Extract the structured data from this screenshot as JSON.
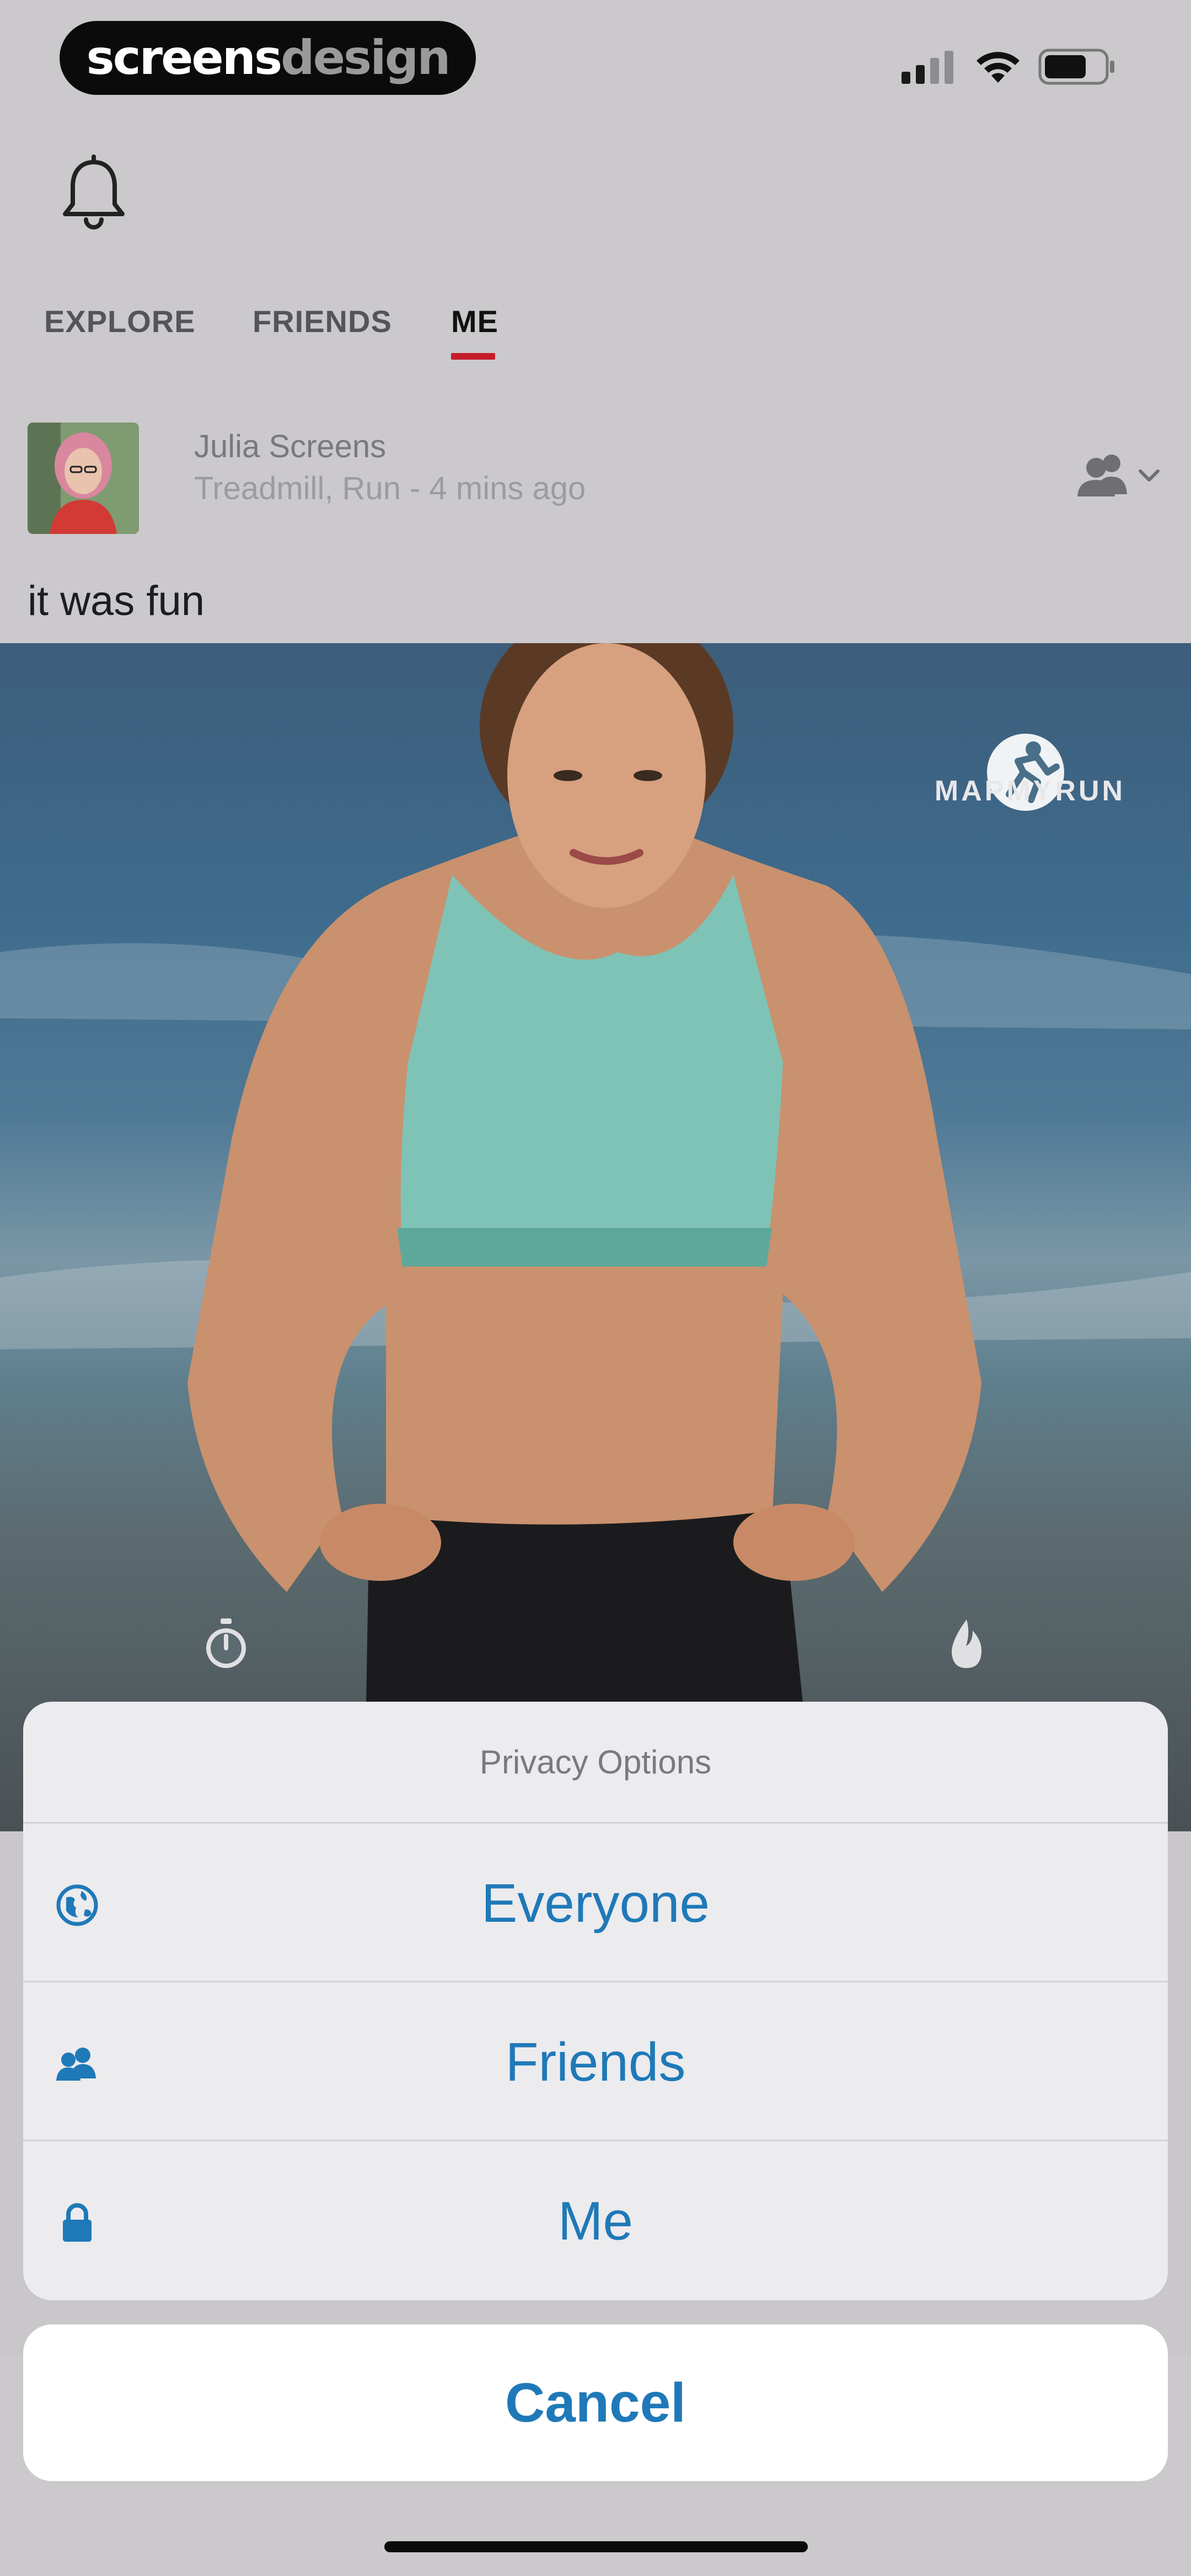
{
  "status_bar": {
    "brand_part1": "screens",
    "brand_part2": "design"
  },
  "tabs": [
    {
      "label": "EXPLORE",
      "active": false
    },
    {
      "label": "FRIENDS",
      "active": false
    },
    {
      "label": "ME",
      "active": true
    }
  ],
  "post": {
    "user_name": "Julia Screens",
    "meta": "Treadmill, Run - 4 mins ago",
    "caption": "it was fun",
    "photo_brand": "MAPMYRUN"
  },
  "action_sheet": {
    "title": "Privacy Options",
    "options": [
      {
        "label": "Everyone",
        "icon": "globe-icon"
      },
      {
        "label": "Friends",
        "icon": "friends-icon"
      },
      {
        "label": "Me",
        "icon": "lock-icon"
      }
    ],
    "cancel_label": "Cancel"
  },
  "colors": {
    "accent_blue": "#1f79b8",
    "tab_underline": "#c41e2a"
  }
}
